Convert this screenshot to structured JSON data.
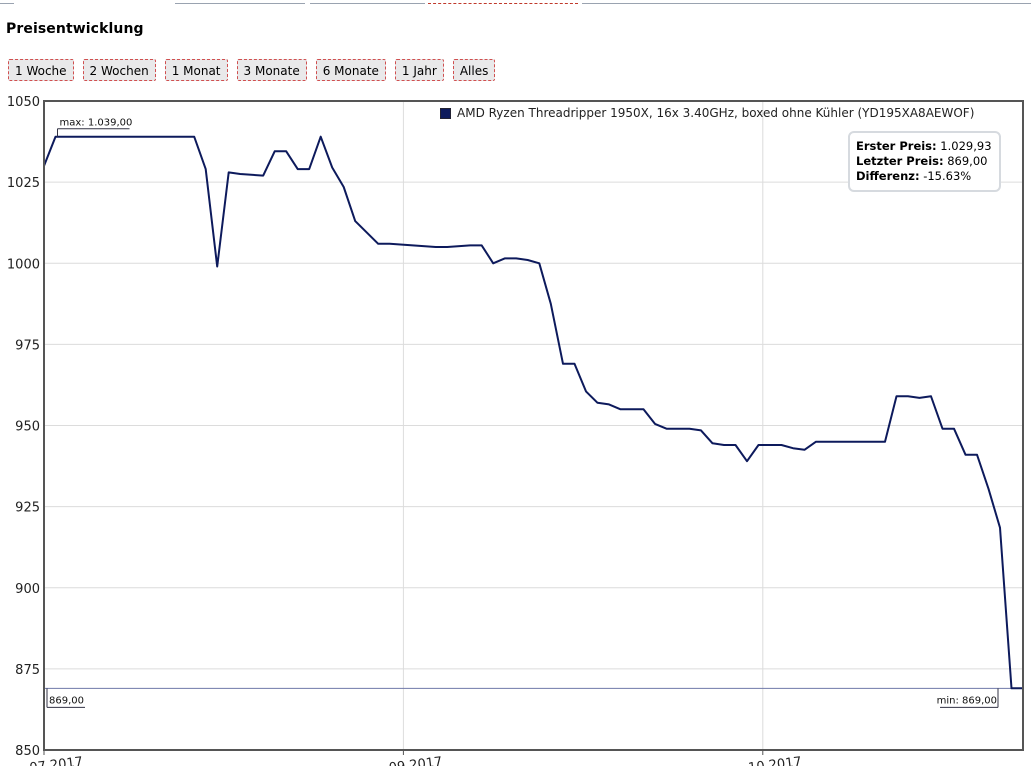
{
  "page": {
    "title": "Preisentwicklung",
    "range_buttons": [
      "1 Woche",
      "2 Wochen",
      "1 Monat",
      "3 Monate",
      "6 Monate",
      "1 Jahr",
      "Alles"
    ]
  },
  "legend": {
    "series_label": "AMD Ryzen Threadripper 1950X, 16x 3.40GHz, boxed ohne Kühler (YD195XA8AEWOF)",
    "color": "#0d1a5c"
  },
  "stats": {
    "first_label": "Erster Preis:",
    "first_value": "1.029,93",
    "last_label": "Letzter Preis:",
    "last_value": "869,00",
    "diff_label": "Differenz:",
    "diff_value": "-15.63%"
  },
  "markers": {
    "max_label": "max: 1.039,00",
    "min_label": "min: 869,00",
    "start_label": "869,00"
  },
  "chart_data": {
    "type": "line",
    "ylim": [
      850,
      1050
    ],
    "yticks": [
      850,
      875,
      900,
      925,
      950,
      975,
      1000,
      1025,
      1050
    ],
    "xticks": [
      {
        "label": "07.2017",
        "x": 0
      },
      {
        "label": "09.2017",
        "x": 50
      },
      {
        "label": "10.2017",
        "x": 100
      }
    ],
    "grid": true,
    "line_color": "#0d1a5c",
    "series": [
      {
        "name": "AMD Ryzen Threadripper 1950X, 16x 3.40GHz, boxed ohne Kühler (YD195XA8AEWOF)",
        "x": [
          0,
          1.6,
          20.9,
          22.5,
          24.1,
          25.7,
          27.3,
          30.5,
          32.1,
          33.7,
          35.3,
          36.9,
          38.5,
          40.1,
          41.7,
          43.3,
          46.5,
          48.1,
          51.3,
          54.5,
          56.1,
          59.3,
          60.9,
          62.5,
          64.1,
          65.7,
          67.3,
          68.9,
          70.5,
          72.2,
          73.8,
          75.4,
          77.0,
          78.6,
          80.2,
          81.8,
          83.4,
          85.0,
          86.6,
          88.2,
          89.8,
          91.4,
          93.0,
          94.6,
          96.2,
          97.8,
          99.4,
          101.0,
          102.6,
          104.2,
          105.8,
          107.4,
          109.0,
          110.6,
          112.2,
          117.0,
          118.6,
          120.2,
          121.8,
          123.4,
          125.0,
          126.6,
          128.2,
          129.8,
          131.4,
          133.0,
          134.6,
          136.2
        ],
        "y": [
          1030,
          1039,
          1039,
          1029,
          999,
          1028,
          1027.5,
          1027,
          1034.5,
          1034.5,
          1029,
          1029,
          1039,
          1029.5,
          1023.5,
          1013,
          1006,
          1006,
          1005.5,
          1005,
          1005,
          1005.5,
          1005.5,
          1000,
          1001.5,
          1001.5,
          1001,
          1000,
          987.5,
          969,
          969,
          960.5,
          957,
          956.5,
          955,
          955,
          955,
          950.5,
          949,
          949,
          949,
          948.5,
          944.5,
          944,
          944,
          939,
          944,
          944,
          944,
          943,
          942.5,
          945,
          945,
          945,
          945,
          945,
          959,
          959,
          958.5,
          959,
          949,
          949,
          941,
          941,
          930.5,
          918.5,
          869,
          869
        ]
      }
    ]
  }
}
